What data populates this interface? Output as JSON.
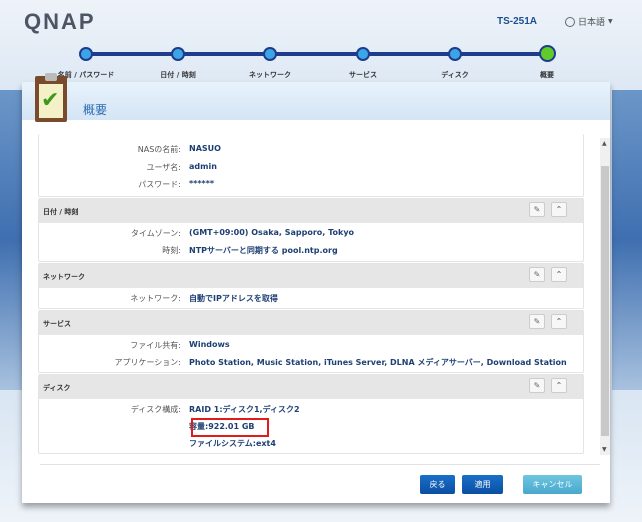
{
  "header": {
    "logo": "QNAP",
    "model": "TS-251A",
    "language": "日本語"
  },
  "steps": [
    {
      "label": "名前 / パスワード"
    },
    {
      "label": "日付 / 時刻"
    },
    {
      "label": "ネットワーク"
    },
    {
      "label": "サービス"
    },
    {
      "label": "ディスク"
    },
    {
      "label": "概要",
      "current": true
    }
  ],
  "page_title": "概要",
  "sections": {
    "account": {
      "rows": [
        {
          "label": "NASの名前:",
          "value": "NASUO"
        },
        {
          "label": "ユーザ名:",
          "value": "admin"
        },
        {
          "label": "パスワード:",
          "value": "******"
        }
      ]
    },
    "datetime": {
      "title": "日付 / 時刻",
      "rows": [
        {
          "label": "タイムゾーン:",
          "value": "(GMT+09:00) Osaka, Sapporo, Tokyo"
        },
        {
          "label": "時刻:",
          "value": "NTPサーバーと同期する pool.ntp.org"
        }
      ]
    },
    "network": {
      "title": "ネットワーク",
      "rows": [
        {
          "label": "ネットワーク:",
          "value": "自動でIPアドレスを取得"
        }
      ]
    },
    "services": {
      "title": "サービス",
      "rows": [
        {
          "label": "ファイル共有:",
          "value": "Windows"
        },
        {
          "label": "アプリケーション:",
          "value": "Photo Station, Music Station, iTunes Server, DLNA メディアサーバー, Download Station"
        }
      ]
    },
    "disk": {
      "title": "ディスク",
      "rows": [
        {
          "label": "ディスク構成:",
          "value": "RAID 1:ディスク1,ディスク2"
        }
      ],
      "capacity": "容量:922.01 GB",
      "filesystem": "ファイルシステム:ext4"
    }
  },
  "buttons": {
    "back": "戻る",
    "apply": "適用",
    "cancel": "キャンセル"
  }
}
